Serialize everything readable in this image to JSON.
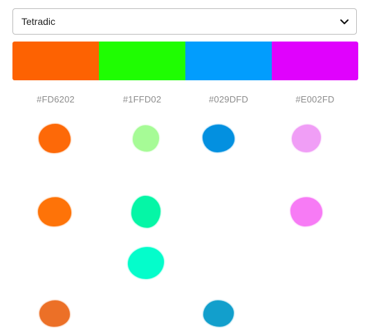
{
  "scheme_select": {
    "selected": "Tetradic"
  },
  "palette": [
    {
      "hex": "#FD6202",
      "color": "#FD6202"
    },
    {
      "hex": "#1FFD02",
      "color": "#1FFD02"
    },
    {
      "hex": "#029DFD",
      "color": "#029DFD"
    },
    {
      "hex": "#E002FD",
      "color": "#E002FD"
    }
  ],
  "variations": [
    {
      "column": 0,
      "row": 0,
      "color": "#FD6908"
    },
    {
      "column": 1,
      "row": 0,
      "color": "#A6FB96"
    },
    {
      "column": 2,
      "row": 0,
      "color": "#0390E0"
    },
    {
      "column": 3,
      "row": 0,
      "color": "#F09EF6"
    },
    {
      "column": 0,
      "row": 1,
      "color": "#FE7308"
    },
    {
      "column": 1,
      "row": 1,
      "color": "#05F6A6"
    },
    {
      "column": 3,
      "row": 1,
      "color": "#F77BF5"
    },
    {
      "column": 1,
      "row": 2,
      "color": "#04FDCB"
    },
    {
      "column": 0,
      "row": 3,
      "color": "#EC7027"
    },
    {
      "column": 2,
      "row": 3,
      "color": "#129FCC"
    }
  ]
}
